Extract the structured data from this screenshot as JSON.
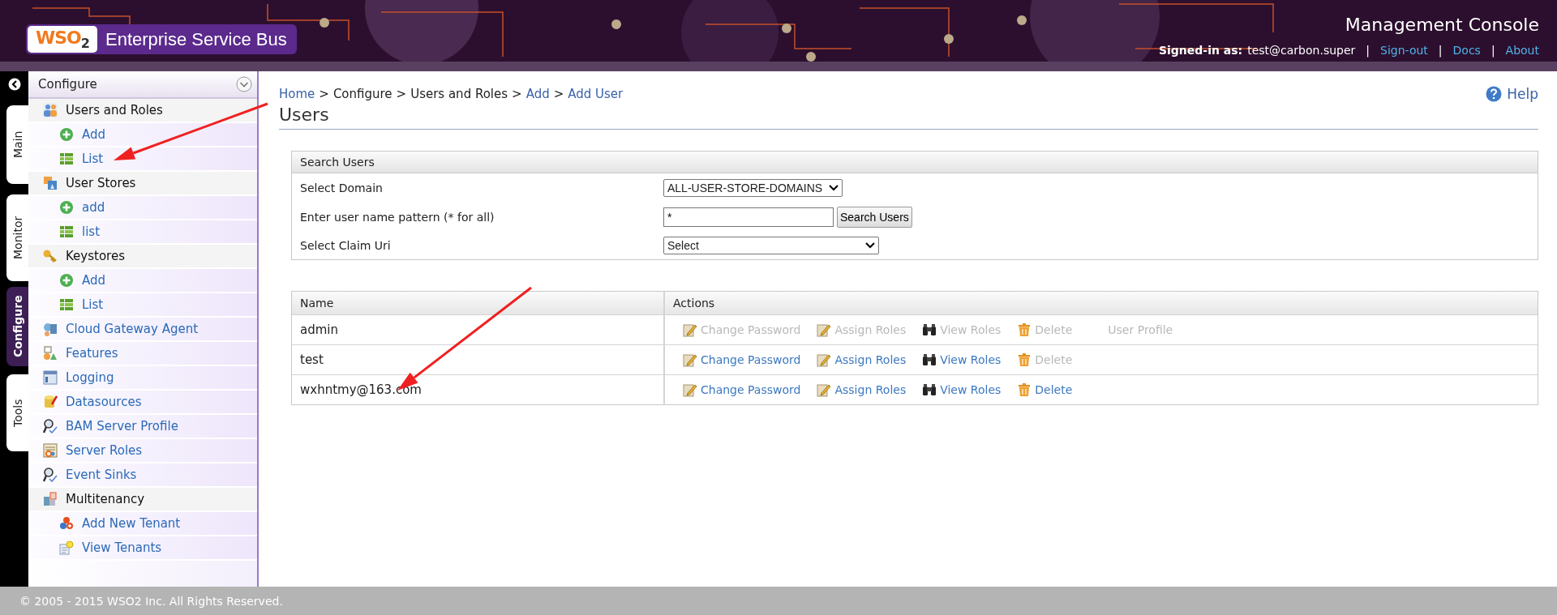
{
  "header": {
    "logo": "WSO$_{2}$",
    "product": "Enterprise Service Bus",
    "title": "Management Console",
    "signed_in_label": "Signed-in as:",
    "user": "test@carbon.super",
    "link_separator": "|",
    "links": [
      "Sign-out",
      "Docs",
      "About"
    ]
  },
  "side_tabs": [
    {
      "label": "Main",
      "selected": false
    },
    {
      "label": "Monitor",
      "selected": false
    },
    {
      "label": "Configure",
      "selected": true
    },
    {
      "label": "Tools",
      "selected": false
    }
  ],
  "menu": {
    "title": "Configure",
    "items": [
      {
        "label": "Users and Roles",
        "children": [
          {
            "label": "Add"
          },
          {
            "label": "List"
          }
        ]
      },
      {
        "label": "User Stores",
        "children": [
          {
            "label": "add"
          },
          {
            "label": "list"
          }
        ]
      },
      {
        "label": "Keystores",
        "children": [
          {
            "label": "Add"
          },
          {
            "label": "List"
          }
        ]
      },
      {
        "label": "Cloud Gateway Agent"
      },
      {
        "label": "Features"
      },
      {
        "label": "Logging"
      },
      {
        "label": "Datasources"
      },
      {
        "label": "BAM Server Profile"
      },
      {
        "label": "Server Roles"
      },
      {
        "label": "Event Sinks"
      },
      {
        "label": "Multitenancy",
        "children": [
          {
            "label": "Add New Tenant"
          },
          {
            "label": "View Tenants"
          }
        ]
      }
    ]
  },
  "breadcrumb": {
    "separator": ">",
    "items": [
      {
        "label": "Home",
        "link": true
      },
      {
        "label": "Configure",
        "link": false
      },
      {
        "label": "Users and Roles",
        "link": false
      },
      {
        "label": "Add",
        "link": true
      },
      {
        "label": "Add User",
        "link": true
      }
    ]
  },
  "help": "Help",
  "page_title": "Users",
  "search": {
    "title": "Search Users",
    "rows": [
      {
        "kind": "select",
        "label": "Select Domain",
        "value": "ALL-USER-STORE-DOMAINS"
      },
      {
        "kind": "text",
        "label": "Enter user name pattern (* for all)",
        "value": "*",
        "button": "Search Users"
      },
      {
        "kind": "select",
        "label": "Select Claim Uri",
        "value": "Select"
      }
    ]
  },
  "users": {
    "columns": [
      "Name",
      "Actions"
    ],
    "rows": [
      {
        "name": "admin",
        "actions": [
          {
            "kind": "edit",
            "label": "Change Password",
            "disabled": true
          },
          {
            "kind": "edit",
            "label": "Assign Roles",
            "disabled": true
          },
          {
            "kind": "view",
            "label": "View Roles",
            "disabled": true
          },
          {
            "kind": "delete",
            "label": "Delete",
            "disabled": true
          },
          {
            "kind": "profile",
            "label": "User Profile",
            "disabled": true
          }
        ]
      },
      {
        "name": "test",
        "actions": [
          {
            "kind": "edit",
            "label": "Change Password",
            "disabled": false
          },
          {
            "kind": "edit",
            "label": "Assign Roles",
            "disabled": false
          },
          {
            "kind": "view",
            "label": "View Roles",
            "disabled": false
          },
          {
            "kind": "delete",
            "label": "Delete",
            "disabled": true
          }
        ]
      },
      {
        "name": "wxhntmy@163.com",
        "actions": [
          {
            "kind": "edit",
            "label": "Change Password",
            "disabled": false
          },
          {
            "kind": "edit",
            "label": "Assign Roles",
            "disabled": false
          },
          {
            "kind": "view",
            "label": "View Roles",
            "disabled": false
          },
          {
            "kind": "delete",
            "label": "Delete",
            "disabled": false
          }
        ]
      }
    ]
  },
  "footer": "© 2005 - 2015 WSO2 Inc. All Rights Reserved.",
  "annotations": [
    {
      "kind": "arrow"
    },
    {
      "kind": "arrow"
    }
  ]
}
